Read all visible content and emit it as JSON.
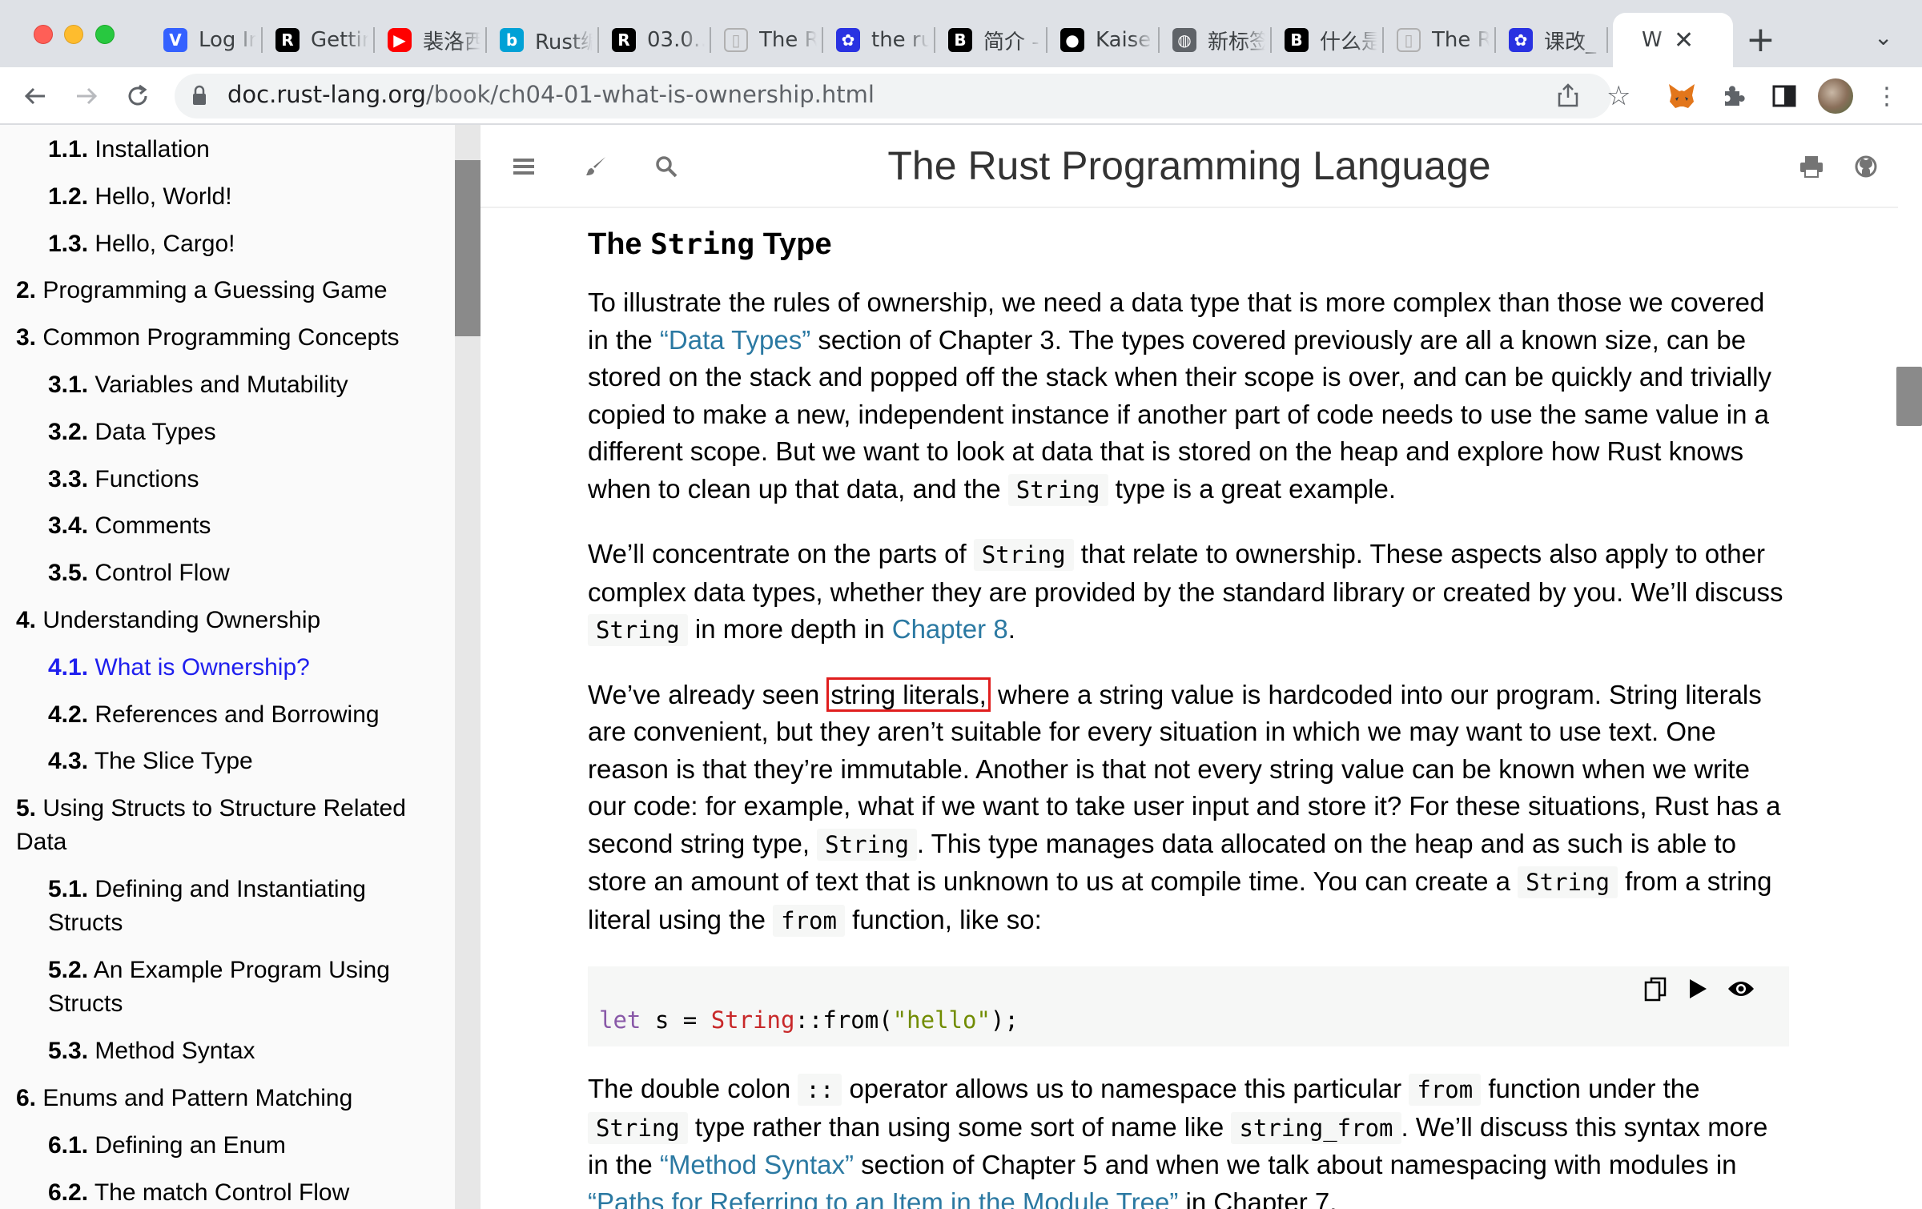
{
  "browser": {
    "tabs": [
      {
        "label": "Log In",
        "icon": "vercel-v-icon",
        "icon_char": "V",
        "icon_color": "#3461ff"
      },
      {
        "label": "Getting",
        "icon": "rust-logo-icon",
        "icon_char": "R",
        "icon_color": "#000000"
      },
      {
        "label": "裴洛西",
        "icon": "youtube-icon",
        "icon_char": "▶",
        "icon_color": "#ff0000"
      },
      {
        "label": "Rust编",
        "icon": "bilibili-icon",
        "icon_char": "b",
        "icon_color": "#00a1d6"
      },
      {
        "label": "03.0…",
        "icon": "rust-logo-icon",
        "icon_char": "R",
        "icon_color": "#000000"
      },
      {
        "label": "The R",
        "icon": "book-page-icon",
        "icon_char": "▯",
        "icon_color": "#b0b0b0"
      },
      {
        "label": "the ru",
        "icon": "baidu-paw-icon",
        "icon_char": "✿",
        "icon_color": "#2932e1"
      },
      {
        "label": "简介 -",
        "icon": "mdbook-icon",
        "icon_char": "B",
        "icon_color": "#000000"
      },
      {
        "label": "Kaiser",
        "icon": "github-icon",
        "icon_char": "●",
        "icon_color": "#000000"
      },
      {
        "label": "新标签",
        "icon": "globe-icon",
        "icon_char": "◍",
        "icon_color": "#5f6368"
      },
      {
        "label": "什么是",
        "icon": "mdbook-icon",
        "icon_char": "B",
        "icon_color": "#000000"
      },
      {
        "label": "The R",
        "icon": "book-page-icon",
        "icon_char": "▯",
        "icon_color": "#b0b0b0"
      },
      {
        "label": "课改_",
        "icon": "baidu-paw-icon",
        "icon_char": "✿",
        "icon_color": "#2932e1"
      }
    ],
    "active_tab": {
      "label": "W",
      "close": "✕"
    },
    "new_tab": "+",
    "tab_menu": "⌄",
    "url_host": "doc.rust-lang.org",
    "url_path": "/book/ch04-01-what-is-ownership.html"
  },
  "sidebar": {
    "items": [
      {
        "num": "1.1.",
        "label": "Installation",
        "level": 2,
        "active": false
      },
      {
        "num": "1.2.",
        "label": "Hello, World!",
        "level": 2,
        "active": false
      },
      {
        "num": "1.3.",
        "label": "Hello, Cargo!",
        "level": 2,
        "active": false
      },
      {
        "num": "2.",
        "label": "Programming a Guessing Game",
        "level": 1,
        "active": false
      },
      {
        "num": "3.",
        "label": "Common Programming Concepts",
        "level": 1,
        "active": false
      },
      {
        "num": "3.1.",
        "label": "Variables and Mutability",
        "level": 2,
        "active": false
      },
      {
        "num": "3.2.",
        "label": "Data Types",
        "level": 2,
        "active": false
      },
      {
        "num": "3.3.",
        "label": "Functions",
        "level": 2,
        "active": false
      },
      {
        "num": "3.4.",
        "label": "Comments",
        "level": 2,
        "active": false
      },
      {
        "num": "3.5.",
        "label": "Control Flow",
        "level": 2,
        "active": false
      },
      {
        "num": "4.",
        "label": "Understanding Ownership",
        "level": 1,
        "active": false
      },
      {
        "num": "4.1.",
        "label": "What is Ownership?",
        "level": 2,
        "active": true
      },
      {
        "num": "4.2.",
        "label": "References and Borrowing",
        "level": 2,
        "active": false
      },
      {
        "num": "4.3.",
        "label": "The Slice Type",
        "level": 2,
        "active": false
      },
      {
        "num": "5.",
        "label": "Using Structs to Structure Related",
        "label2": "Data",
        "level": 1,
        "active": false
      },
      {
        "num": "5.1.",
        "label": "Defining and Instantiating",
        "label2": "Structs",
        "level": 2,
        "active": false
      },
      {
        "num": "5.2.",
        "label": "An Example Program Using",
        "label2": "Structs",
        "level": 2,
        "active": false
      },
      {
        "num": "5.3.",
        "label": "Method Syntax",
        "level": 2,
        "active": false
      },
      {
        "num": "6.",
        "label": "Enums and Pattern Matching",
        "level": 1,
        "active": false
      },
      {
        "num": "6.1.",
        "label": "Defining an Enum",
        "level": 2,
        "active": false
      },
      {
        "num": "6.2.",
        "label": "The match Control Flow",
        "level": 2,
        "active": false
      }
    ]
  },
  "menubar": {
    "title": "The Rust Programming Language"
  },
  "article": {
    "heading_pre": "The ",
    "heading_code": "String",
    "heading_post": " Type",
    "p1": {
      "t1": "To illustrate the rules of ownership, we need a data type that is more complex than those we covered in the ",
      "link": "“Data Types”",
      "t2": " section of Chapter 3. The types covered previously are all a known size, can be stored on the stack and popped off the stack when their scope is over, and can be quickly and trivially copied to make a new, independent instance if another part of code needs to use the same value in a different scope. But we want to look at data that is stored on the heap and explore how Rust knows when to clean up that data, and the ",
      "code": "String",
      "t3": " type is a great example."
    },
    "p2": {
      "t1": "We’ll concentrate on the parts of ",
      "code1": "String",
      "t2": " that relate to ownership. These aspects also apply to other complex data types, whether they are provided by the standard library or created by you. We’ll discuss ",
      "code2": "String",
      "t3": " in more depth in ",
      "link": "Chapter 8",
      "t4": "."
    },
    "p3": {
      "t1": "We’ve already seen ",
      "highlight": "string literals,",
      "t2": " where a string value is hardcoded into our program. String literals are convenient, but they aren’t suitable for every situation in which we may want to use text. One reason is that they’re immutable. Another is that not every string value can be known when we write our code: for example, what if we want to take user input and store it? For these situations, Rust has a second string type, ",
      "code1": "String",
      "t3": ". This type manages data allocated on the heap and as such is able to store an amount of text that is unknown to us at compile time. You can create a ",
      "code2": "String",
      "t4": " from a string literal using the ",
      "code3": "from",
      "t5": " function, like so:"
    },
    "code": {
      "kw": "let",
      "mid": " s = ",
      "ty": "String",
      "call": "::from(",
      "str": "\"hello\"",
      "end": ");"
    },
    "p4": {
      "t1": "The double colon ",
      "code1": "::",
      "t2": " operator allows us to namespace this particular ",
      "code2": "from",
      "t3": " function under the ",
      "code3": "String",
      "t4": " type rather than using some sort of name like ",
      "code4": "string_from",
      "t5": ". We’ll discuss this syntax more in the ",
      "link": "“Method Syntax”",
      "t6": " section of Chapter 5 and when we talk about namespacing with modules in ",
      "link2": "“Paths for Referring to an Item in the Module Tree”",
      "t7": " in Chapter 7."
    }
  },
  "colors": {
    "link": "#2b79a2",
    "active_nav": "#1f1fee",
    "highlight_box": "#e01e1e"
  }
}
